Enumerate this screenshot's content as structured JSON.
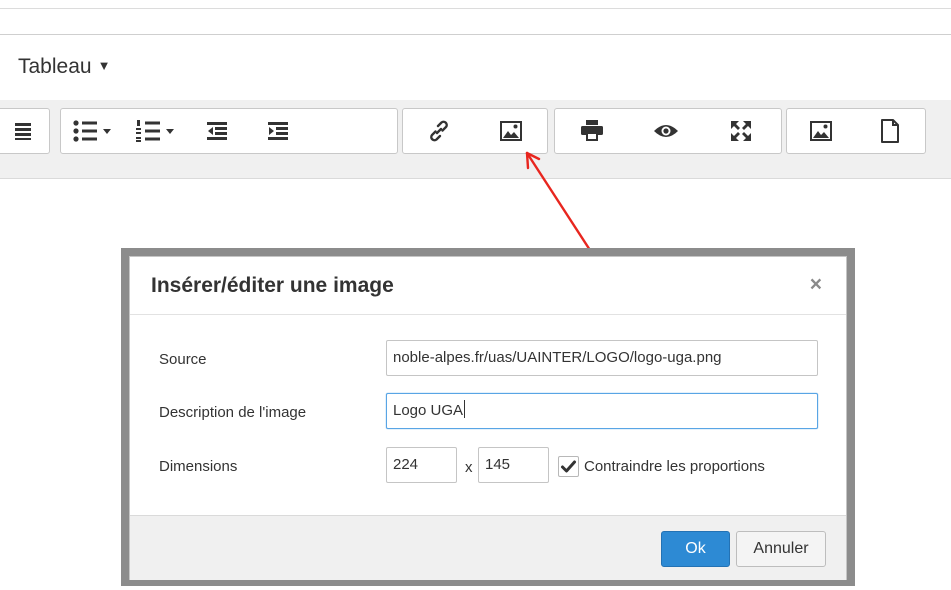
{
  "menubar": {
    "menu_label": "Tableau"
  },
  "toolbar": {
    "icons": [
      "align-justify-icon",
      "bullet-list-icon",
      "numbered-list-icon",
      "outdent-icon",
      "indent-icon",
      "link-icon",
      "image-icon",
      "print-icon",
      "preview-icon",
      "fullscreen-icon",
      "image-icon",
      "new-document-icon"
    ]
  },
  "annotation": {
    "arrow_color": "#e8261f"
  },
  "dialog": {
    "title": "Insérer/éditer une image",
    "close_glyph": "×",
    "source_label": "Source",
    "source_value": "noble-alpes.fr/uas/UAINTER/LOGO/logo-uga.png",
    "description_label": "Description de l'image",
    "description_value": "Logo UGA",
    "dimensions_label": "Dimensions",
    "width_value": "224",
    "x_separator": "x",
    "height_value": "145",
    "constrain_checked": true,
    "constrain_label": "Contraindre les proportions",
    "ok_label": "Ok",
    "cancel_label": "Annuler",
    "accent_color": "#2d8ad4"
  }
}
